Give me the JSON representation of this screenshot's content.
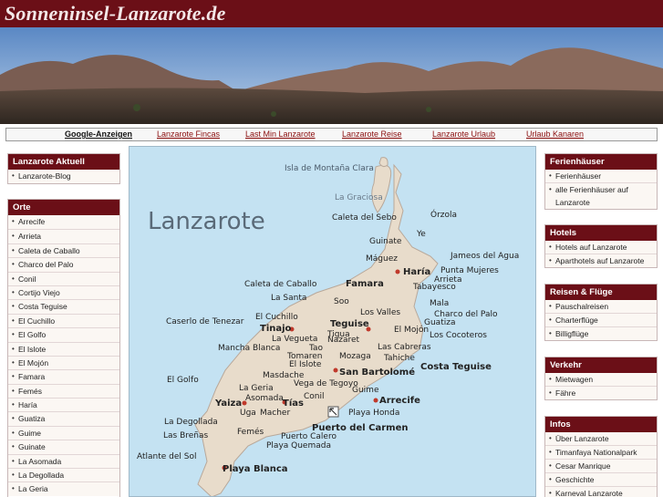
{
  "header": {
    "title": "Sonneninsel-Lanzarote.de"
  },
  "ads": {
    "title": "Google-Anzeigen",
    "links": [
      "Lanzarote Fincas",
      "Last Min Lanzarote",
      "Lanzarote Reise",
      "Lanzarote Urlaub",
      "Urlaub Kanaren"
    ]
  },
  "left": {
    "aktuell": {
      "title": "Lanzarote Aktuell",
      "items": [
        "Lanzarote-Blog"
      ]
    },
    "orte": {
      "title": "Orte",
      "items": [
        "Arrecife",
        "Arrieta",
        "Caleta de Caballo",
        "Charco del Palo",
        "Conil",
        "Cortijo Viejo",
        "Costa Teguise",
        "El Cuchillo",
        "El Golfo",
        "El Islote",
        "El Mojón",
        "Famara",
        "Femés",
        "Haría",
        "Guatiza",
        "Guime",
        "Guinate",
        "La Asomada",
        "La Degollada",
        "La Geria"
      ]
    }
  },
  "right": {
    "ferienhaeuser": {
      "title": "Ferienhäuser",
      "items": [
        "Ferienhäuser",
        "alle Ferienhäuser auf Lanzarote"
      ]
    },
    "hotels": {
      "title": "Hotels",
      "items": [
        "Hotels auf Lanzarote",
        "Aparthotels auf Lanzarote"
      ]
    },
    "reisen": {
      "title": "Reisen & Flüge",
      "items": [
        "Pauschalreisen",
        "Charterflüge",
        "Billigflüge"
      ]
    },
    "verkehr": {
      "title": "Verkehr",
      "items": [
        "Mietwagen",
        "Fähre"
      ]
    },
    "infos": {
      "title": "Infos",
      "items": [
        "Über Lanzarote",
        "Timanfaya Nationalpark",
        "Cesar Manrique",
        "Geschichte",
        "Karneval Lanzarote"
      ]
    }
  },
  "map": {
    "title": "Lanzarote",
    "islands": [
      "Isla de Montaña Clara",
      "La Graciosa"
    ],
    "bold_places": [
      "Haría",
      "Famara",
      "Tinajo",
      "Teguise",
      "San Bartolomé",
      "Costa Teguise",
      "Yaiza",
      "Tías",
      "Arrecife",
      "Puerto del Carmen",
      "Playa Blanca"
    ],
    "places": [
      "Caleta del Sebo",
      "Órzola",
      "Ye",
      "Guinate",
      "Máguez",
      "Jameos del Agua",
      "Punta Mujeres",
      "Arrieta",
      "Tabayesco",
      "Caleta de Caballo",
      "La Santa",
      "Soo",
      "Mala",
      "Los Valles",
      "Charco del Palo",
      "Caserlo de Tenezar",
      "El Cuchillo",
      "El Mojón",
      "Guatiza",
      "La Vegueta",
      "Tigua",
      "Nazaret",
      "Los Cocoteros",
      "Mancha Blanca",
      "Tao",
      "Las Cabreras",
      "Tomaren",
      "Mozaga",
      "Tahiche",
      "El Islote",
      "El Golfo",
      "Masdache",
      "Vega de Tegoyo",
      "La Geria",
      "Guime",
      "Asomada",
      "Conil",
      "Uga",
      "Macher",
      "Playa Honda",
      "La Degollada",
      "Femés",
      "Puerto Calero",
      "Las Breñas",
      "Playa Quemada",
      "Atlante del Sol"
    ]
  },
  "colors": {
    "brand": "#6b0f17",
    "sea": "#c4e2f2",
    "land": "#e8dccb",
    "link": "#8b0d0d"
  }
}
